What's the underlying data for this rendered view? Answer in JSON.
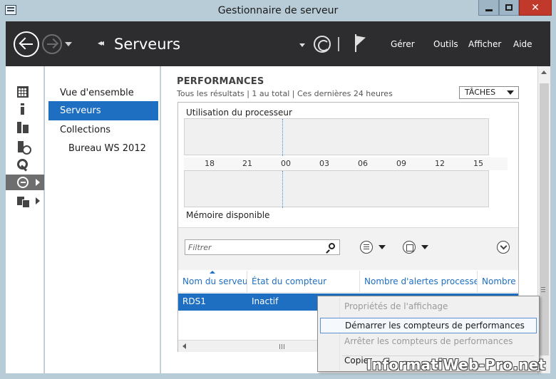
{
  "window": {
    "title": "Gestionnaire de serveur",
    "controls": {
      "close": "✕"
    }
  },
  "header": {
    "breadcrumb_arrows": "◂◂",
    "title": "Serveurs",
    "menu": [
      "Gérer",
      "Outils",
      "Afficher",
      "Aide"
    ]
  },
  "rail": {
    "icons": [
      "dashboard-icon",
      "info-icon",
      "all-servers-icon",
      "file-services-icon",
      "tools-icon",
      "remote-desktop-icon",
      "file-storage-icon"
    ],
    "active_index": 5
  },
  "nav": {
    "items": [
      {
        "label": "Vue d'ensemble"
      },
      {
        "label": "Serveurs"
      },
      {
        "label": "Collections"
      },
      {
        "label": "Bureau WS 2012"
      }
    ],
    "selected_index": 1
  },
  "performance": {
    "title": "PERFORMANCES",
    "subtitle": "Tous les résultats | 1 au total  |  Ces dernières 24 heures",
    "tasks_label": "TÂCHES",
    "chart_cpu_label": "Utilisation du processeur",
    "chart_mem_label": "Mémoire disponible",
    "time_ticks": [
      "18",
      "21",
      "00",
      "03",
      "06",
      "09",
      "12",
      "15"
    ],
    "filter_placeholder": "Filtrer"
  },
  "table": {
    "columns": [
      "Nom du serveur",
      "État du compteur",
      "Nombre d'alertes processeur",
      "Nombre d"
    ],
    "rows": [
      {
        "server": "RDS1",
        "status": "Inactif"
      }
    ]
  },
  "context_menu": {
    "items": [
      {
        "label": "Propriétés de l'affichage",
        "disabled": true
      },
      {
        "label": "Démarrer les compteurs de performances",
        "disabled": false
      },
      {
        "label": "Arrêter les compteurs de performances",
        "disabled": true
      },
      {
        "label": "Copier",
        "disabled": false
      }
    ]
  },
  "watermark": "InformatiWeb-Pro.net",
  "colors": {
    "selection": "#1e6fc1",
    "header_bg": "#2d2d30",
    "frame": "#b8ccd8",
    "close": "#c0392b"
  }
}
